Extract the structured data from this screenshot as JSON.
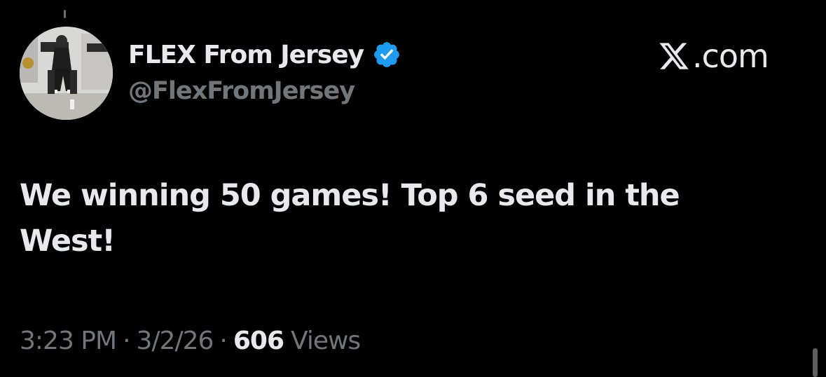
{
  "author": {
    "display_name": "FLEX From Jersey",
    "handle": "@FlexFromJersey",
    "verified": true,
    "avatar_icon": "profile-photo"
  },
  "brand": {
    "logo_icon": "x-logo-icon",
    "domain_suffix": ".com"
  },
  "tweet": {
    "text": "We winning 50 games! Top 6 seed in the West!"
  },
  "meta": {
    "time": "3:23 PM",
    "separator": "·",
    "date": "3/2/26",
    "views_count": "606",
    "views_label": "Views"
  },
  "colors": {
    "background": "#000000",
    "primary_text": "#e7e9ea",
    "secondary_text": "#71767b",
    "verified_badge": "#1d9bf0"
  }
}
